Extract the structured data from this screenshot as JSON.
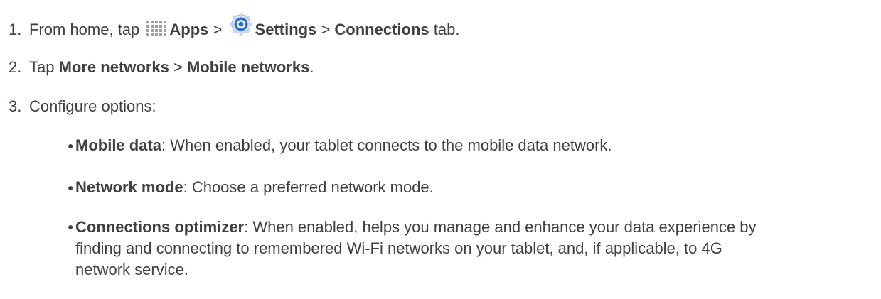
{
  "steps": [
    {
      "number": "1.",
      "lead": "From home, tap",
      "apps": "Apps",
      "sep1": ">",
      "settings": "Settings",
      "sep2": ">",
      "connections": "Connections",
      "tail": "tab."
    },
    {
      "number": "2.",
      "lead": "Tap",
      "more_networks": "More networks",
      "sep": ">",
      "mobile_networks": "Mobile networks",
      "tail": "."
    },
    {
      "number": "3.",
      "text": "Configure options:"
    }
  ],
  "options": [
    {
      "name": "Mobile data",
      "desc": ": When enabled, your tablet connects to the mobile data network."
    },
    {
      "name": "Network mode",
      "desc": ": Choose a preferred network mode."
    },
    {
      "name": "Connections optimizer",
      "desc": ": When enabled, helps you manage and enhance your data experience by finding and connecting to remembered Wi-Fi networks on your tablet, and, if applicable, to 4G network service."
    }
  ],
  "icons": {
    "apps": "apps-grid-icon",
    "settings": "settings-gear-icon"
  },
  "colors": {
    "text": "#404040",
    "apps_icon": "#9aa0a6",
    "settings_icon": "#2f6fc9"
  }
}
